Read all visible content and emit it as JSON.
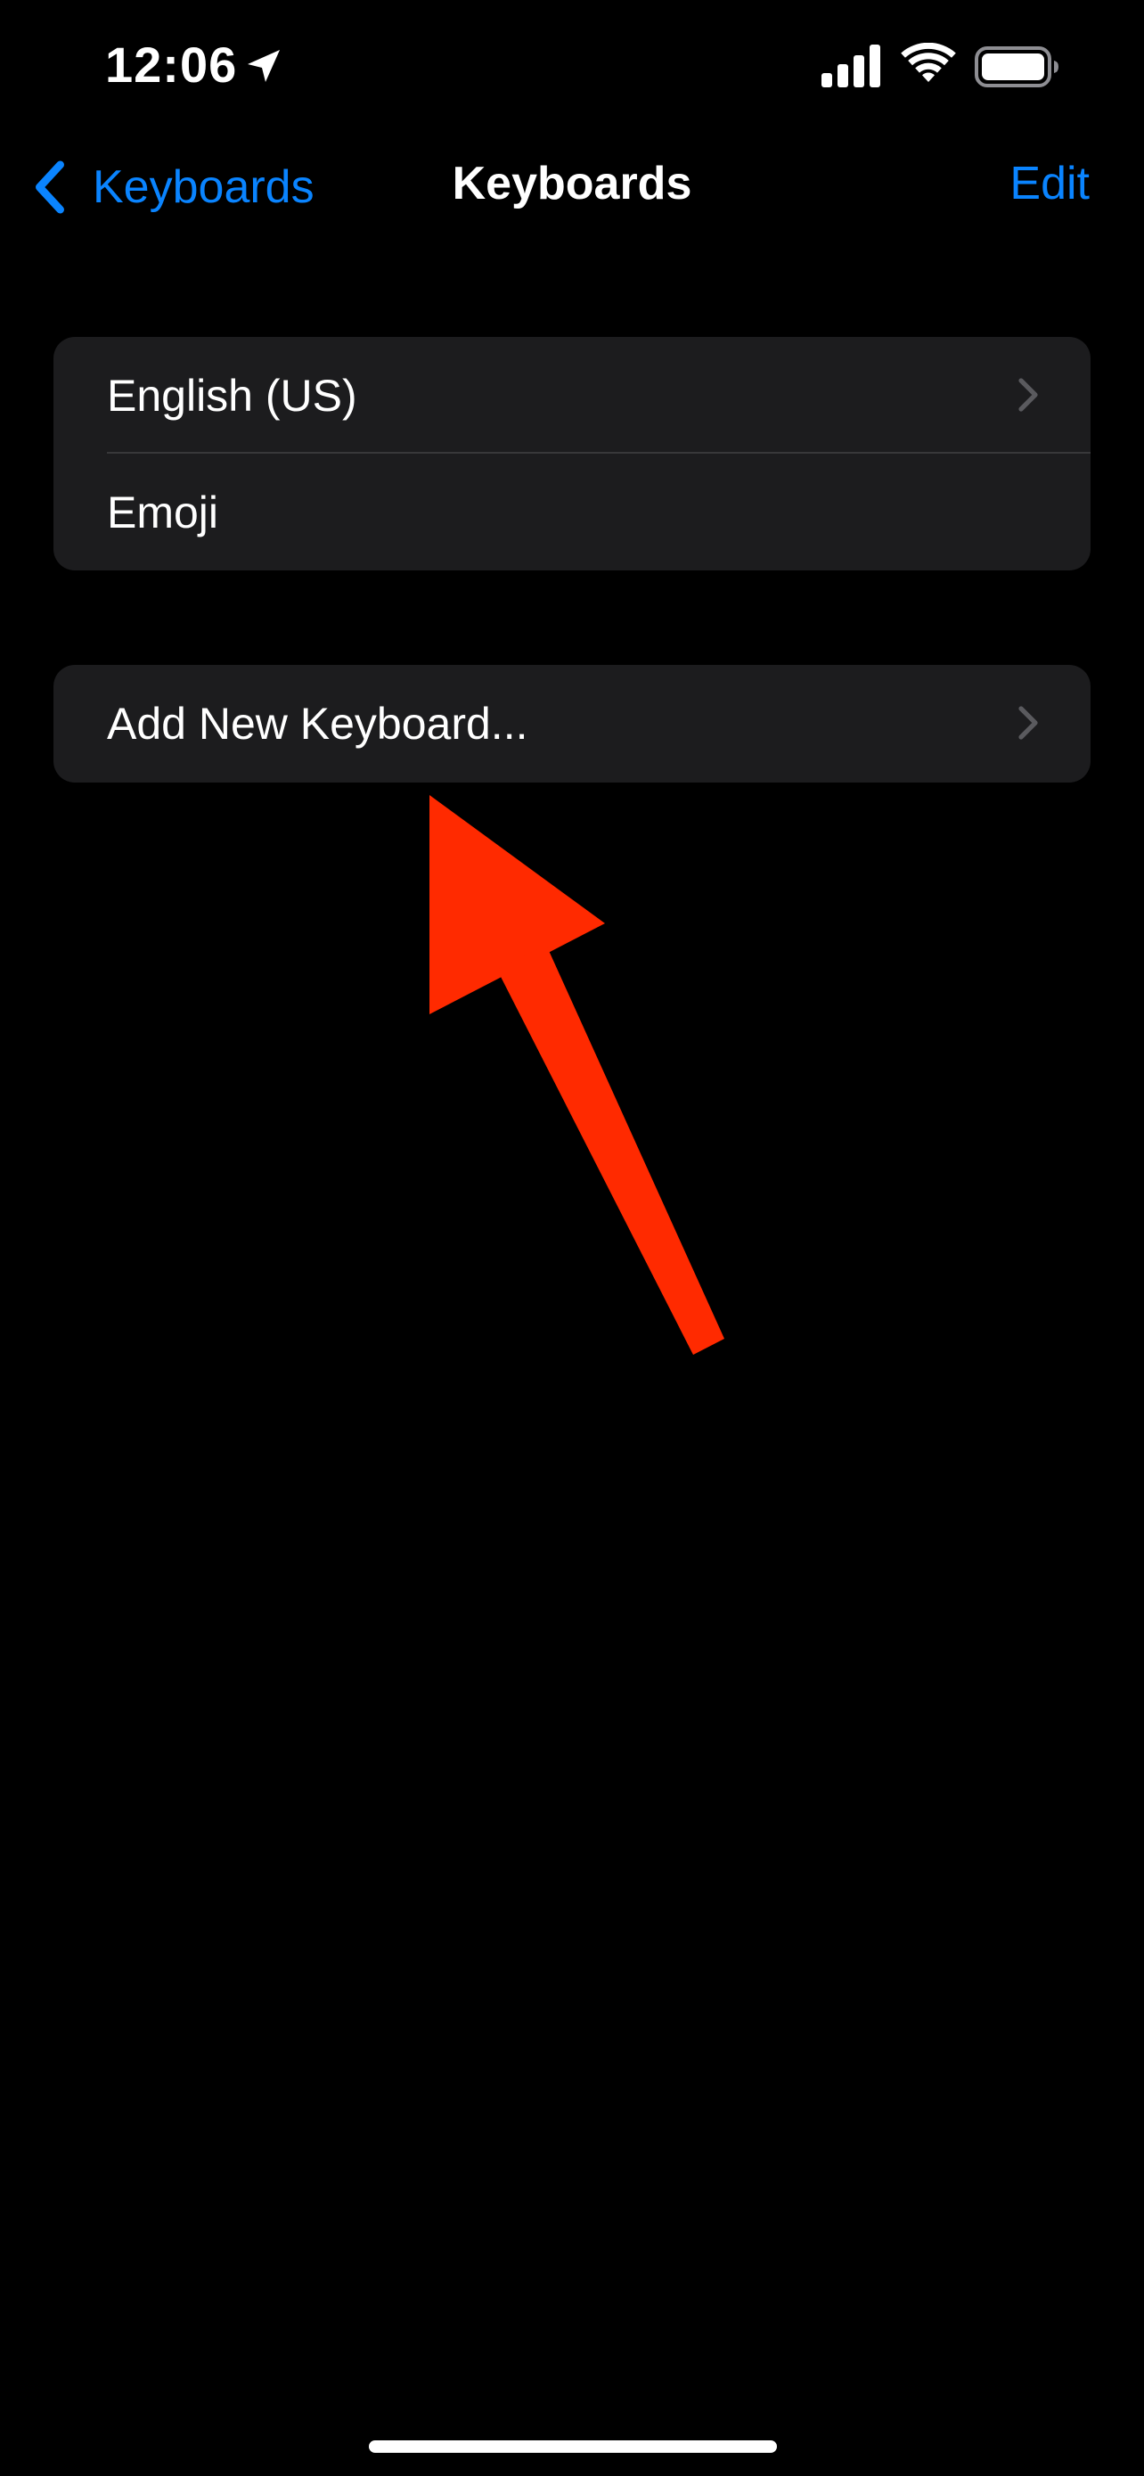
{
  "status_bar": {
    "time": "12:06",
    "icons": [
      "location-arrow-icon",
      "cellular-signal-icon",
      "wifi-icon",
      "battery-icon"
    ]
  },
  "nav": {
    "back_label": "Keyboards",
    "title": "Keyboards",
    "edit_label": "Edit"
  },
  "keyboards": [
    {
      "label": "English (US)",
      "has_chevron": true
    },
    {
      "label": "Emoji",
      "has_chevron": false
    }
  ],
  "add_keyboard": {
    "label": "Add New Keyboard...",
    "has_chevron": true
  },
  "colors": {
    "background": "#000000",
    "group_background": "#1c1c1e",
    "accent": "#0a84ff",
    "annotation_arrow": "#ff2a00",
    "chevron": "#5a5a5e"
  }
}
